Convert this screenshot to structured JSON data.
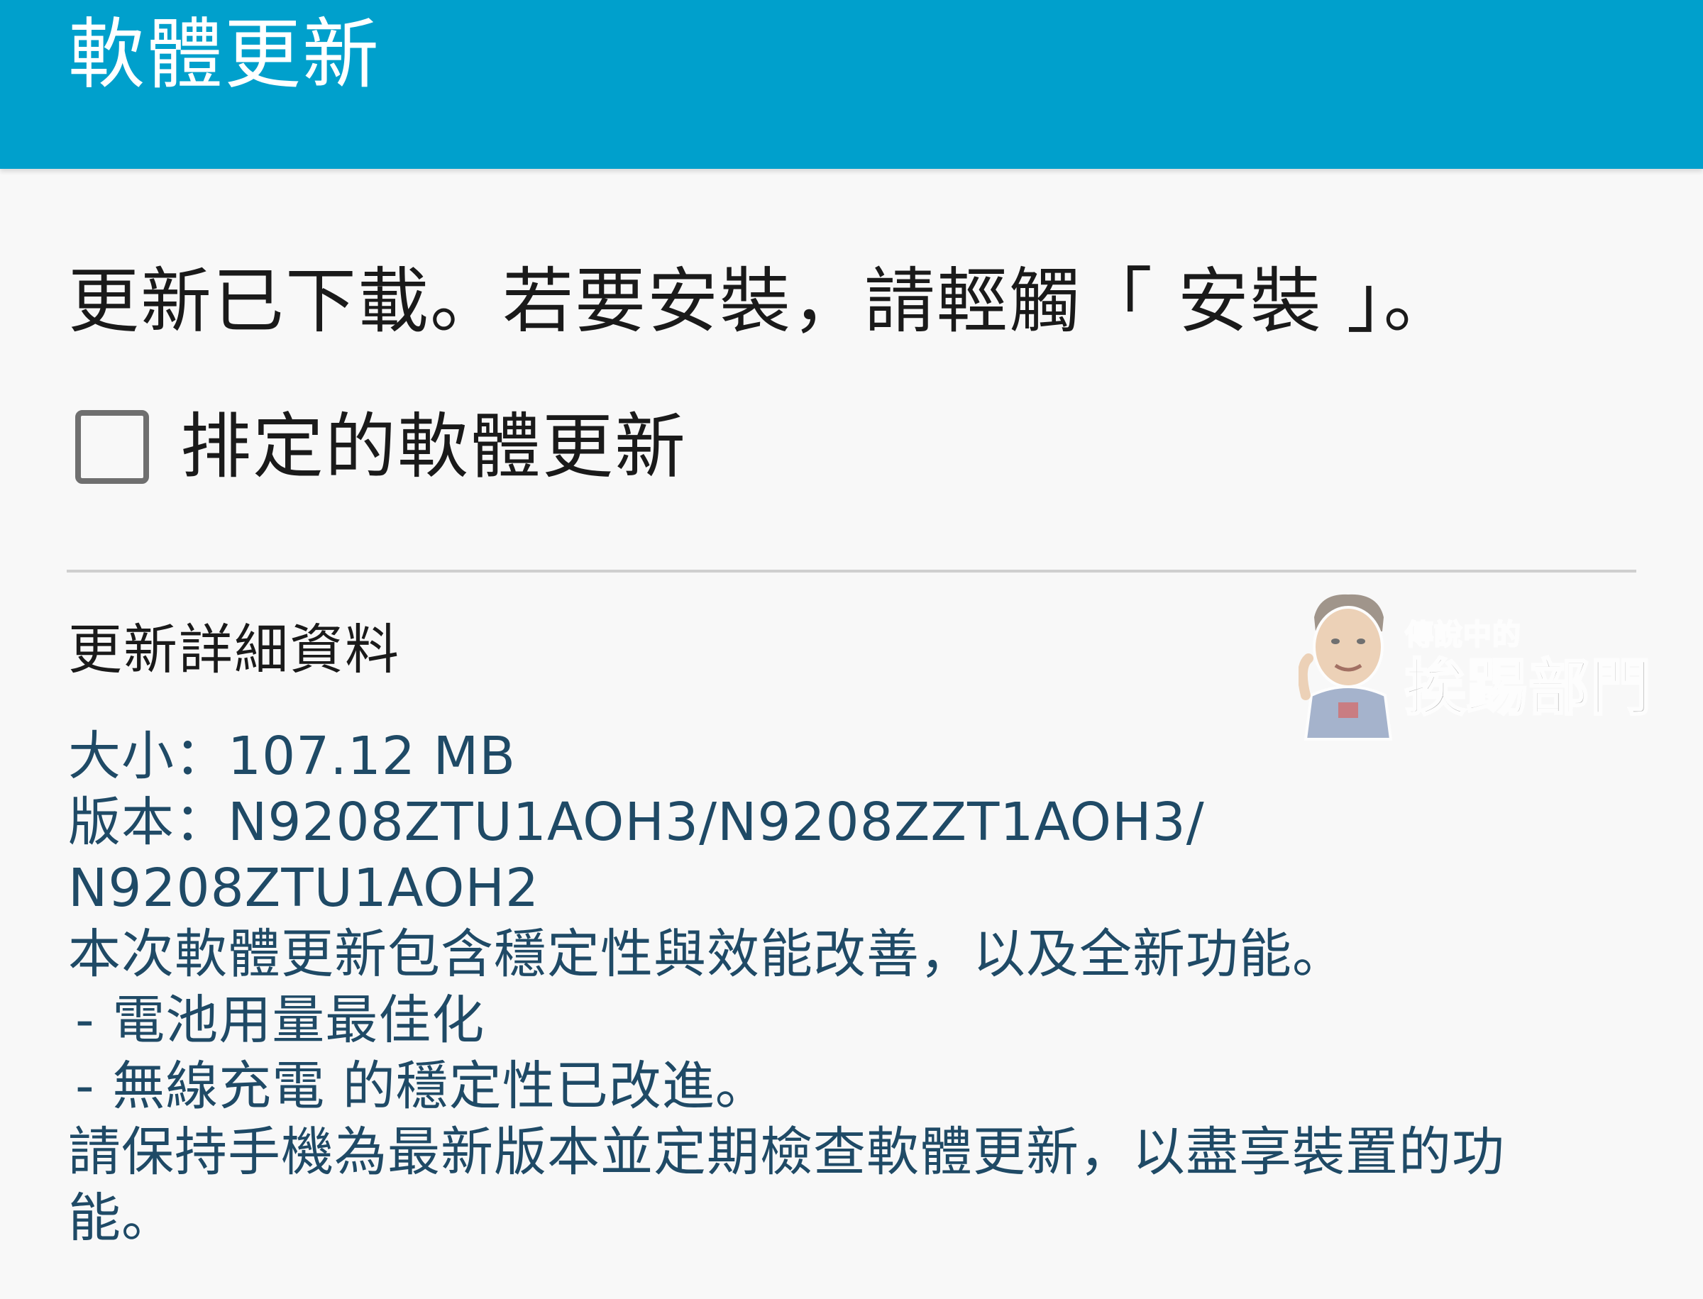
{
  "app_bar": {
    "title": "軟體更新",
    "color": "#00a0cc"
  },
  "message": "更新已下載。若要安裝，請輕觸「 安裝 」。",
  "scheduled_update": {
    "label": "排定的軟體更新",
    "checked": false
  },
  "details": {
    "title": "更新詳細資料",
    "lines": [
      "大小：107.12 MB",
      "版本：N9208ZTU1AOH3/N9208ZZT1AOH3/",
      "N9208ZTU1AOH2",
      "本次軟體更新包含穩定性與效能改善，以及全新功能。",
      " - 電池用量最佳化",
      " - 無線充電 的穩定性已改進。",
      "請保持手機為最新版本並定期檢查軟體更新，以盡享裝置的功",
      "能。"
    ],
    "text_color": "#1f4a66"
  },
  "watermark": {
    "small_text": "傳說中的",
    "big_text": "挨踢部門",
    "icon": "mascot-face-icon"
  }
}
